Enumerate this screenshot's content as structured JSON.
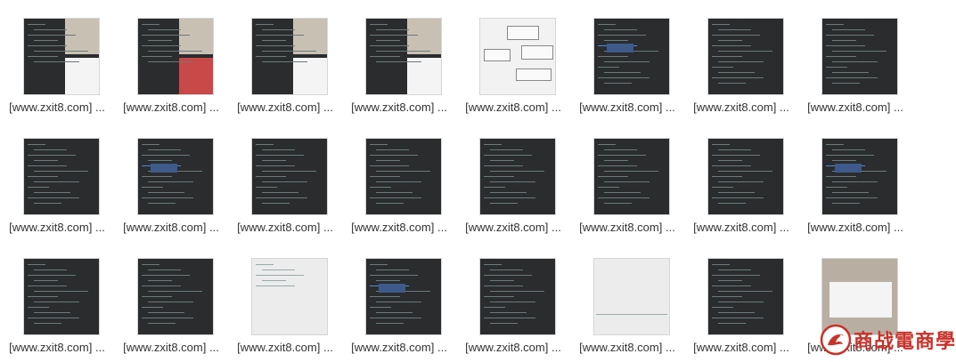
{
  "files": [
    {
      "caption": "[www.zxit8.com] ...",
      "variant": "dark-split"
    },
    {
      "caption": "[www.zxit8.com] ...",
      "variant": "dark-split-red"
    },
    {
      "caption": "[www.zxit8.com] ...",
      "variant": "dark-split"
    },
    {
      "caption": "[www.zxit8.com] ...",
      "variant": "dark-split"
    },
    {
      "caption": "[www.zxit8.com] ...",
      "variant": "diagram"
    },
    {
      "caption": "[www.zxit8.com] ...",
      "variant": "code-hi"
    },
    {
      "caption": "[www.zxit8.com] ...",
      "variant": "code"
    },
    {
      "caption": "[www.zxit8.com] ...",
      "variant": "code"
    },
    {
      "caption": "[www.zxit8.com] ...",
      "variant": "code"
    },
    {
      "caption": "[www.zxit8.com] ...",
      "variant": "code-hi"
    },
    {
      "caption": "[www.zxit8.com] ...",
      "variant": "code"
    },
    {
      "caption": "[www.zxit8.com] ...",
      "variant": "code"
    },
    {
      "caption": "[www.zxit8.com] ...",
      "variant": "code"
    },
    {
      "caption": "[www.zxit8.com] ...",
      "variant": "code"
    },
    {
      "caption": "[www.zxit8.com] ...",
      "variant": "code"
    },
    {
      "caption": "[www.zxit8.com] ...",
      "variant": "code-hi"
    },
    {
      "caption": "[www.zxit8.com] ...",
      "variant": "code"
    },
    {
      "caption": "[www.zxit8.com] ...",
      "variant": "code"
    },
    {
      "caption": "[www.zxit8.com] ...",
      "variant": "light"
    },
    {
      "caption": "[www.zxit8.com] ...",
      "variant": "code-hi"
    },
    {
      "caption": "[www.zxit8.com] ...",
      "variant": "code"
    },
    {
      "caption": "[www.zxit8.com] ...",
      "variant": "light-plain"
    },
    {
      "caption": "[www.zxit8.com] ...",
      "variant": "code"
    },
    {
      "caption": "[www.zxit8.com] ...",
      "variant": "beige"
    }
  ],
  "logo": {
    "text": "商战電商學院",
    "icon": "dragon-logo-icon"
  }
}
